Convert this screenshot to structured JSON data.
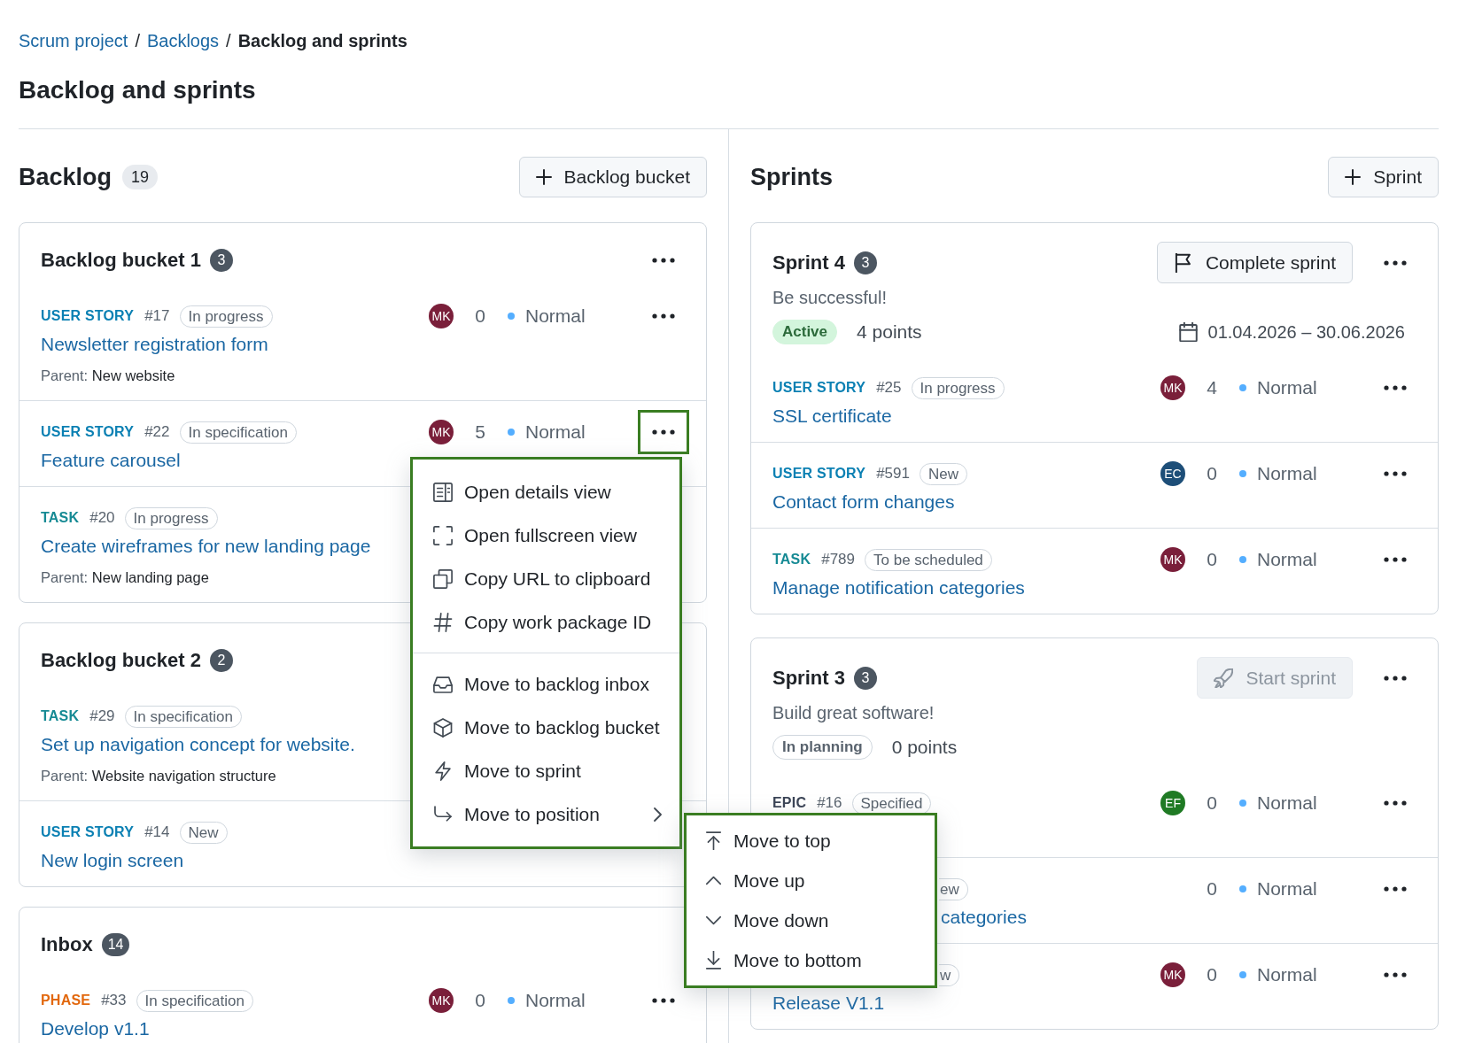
{
  "breadcrumb": {
    "separator": "/",
    "items": [
      {
        "label": "Scrum project",
        "current": false
      },
      {
        "label": "Backlogs",
        "current": false
      },
      {
        "label": "Backlog and sprints",
        "current": true
      }
    ]
  },
  "page_title": "Backlog and sprints",
  "backlog": {
    "title": "Backlog",
    "count": "19",
    "add_button": "Backlog bucket",
    "buckets": [
      {
        "name": "Backlog bucket 1",
        "count": "3",
        "menu": {
          "open": false
        },
        "items": [
          {
            "type": "USER STORY",
            "color": "#0b80b3",
            "number": "#17",
            "status": "In progress",
            "assignee": {
              "initials": "MK",
              "color": "#7a1f3a"
            },
            "points": "0",
            "priority": "Normal",
            "menu": {
              "open": false
            },
            "title": "Newsletter registration form",
            "parent": {
              "label": "Parent:",
              "name": "New website"
            }
          },
          {
            "type": "USER STORY",
            "color": "#0b80b3",
            "number": "#22",
            "status": "In specification",
            "assignee": {
              "initials": "MK",
              "color": "#7a1f3a"
            },
            "points": "5",
            "priority": "Normal",
            "menu": {
              "open": true
            },
            "title": "Feature carousel"
          },
          {
            "type": "TASK",
            "color": "#168a94",
            "number": "#20",
            "status": "In progress",
            "title": "Create wireframes for new landing page",
            "parent": {
              "label": "Parent:",
              "name": "New landing page"
            }
          }
        ]
      },
      {
        "name": "Backlog bucket 2",
        "count": "2",
        "items": [
          {
            "type": "TASK",
            "color": "#168a94",
            "number": "#29",
            "status": "In specification",
            "title": "Set up navigation concept for website.",
            "parent": {
              "label": "Parent:",
              "name": "Website navigation structure"
            }
          },
          {
            "type": "USER STORY",
            "color": "#0b80b3",
            "number": "#14",
            "status": "New",
            "title": "New login screen"
          }
        ]
      },
      {
        "name": "Inbox",
        "count": "14",
        "items": [
          {
            "type": "PHASE",
            "color": "#e2680e",
            "number": "#33",
            "status": "In specification",
            "assignee": {
              "initials": "MK",
              "color": "#7a1f3a"
            },
            "points": "0",
            "priority": "Normal",
            "menu": {
              "open": false
            },
            "title": "Develop v1.1"
          }
        ]
      }
    ]
  },
  "sprints": {
    "title": "Sprints",
    "add_button": "Sprint",
    "items": [
      {
        "name": "Sprint 4",
        "count": "3",
        "action": {
          "label": "Complete sprint",
          "kind": "complete",
          "disabled": false
        },
        "menu": {
          "open": false
        },
        "goal": "Be successful!",
        "state": {
          "label": "Active",
          "kind": "active"
        },
        "points": "4 points",
        "dates": "01.04.2026 – 30.06.2026",
        "items": [
          {
            "type": "USER STORY",
            "color": "#0b80b3",
            "number": "#25",
            "status": "In progress",
            "assignee": {
              "initials": "MK",
              "color": "#7a1f3a"
            },
            "points": "4",
            "priority": "Normal",
            "menu": {
              "open": false
            },
            "title": "SSL certificate"
          },
          {
            "type": "USER STORY",
            "color": "#0b80b3",
            "number": "#591",
            "status": "New",
            "assignee": {
              "initials": "EC",
              "color": "#1d4e78"
            },
            "points": "0",
            "priority": "Normal",
            "menu": {
              "open": false
            },
            "title": "Contact form changes"
          },
          {
            "type": "TASK",
            "color": "#168a94",
            "number": "#789",
            "status": "To be scheduled",
            "assignee": {
              "initials": "MK",
              "color": "#7a1f3a"
            },
            "points": "0",
            "priority": "Normal",
            "menu": {
              "open": false
            },
            "title": "Manage notification categories"
          }
        ]
      },
      {
        "name": "Sprint 3",
        "count": "3",
        "action": {
          "label": "Start sprint",
          "kind": "start",
          "disabled": true
        },
        "menu": {
          "open": false
        },
        "goal": "Build great software!",
        "state": {
          "label": "In planning",
          "kind": "planning"
        },
        "points": "0 points",
        "items": [
          {
            "type": "EPIC",
            "color": "#3b4456",
            "number": "#16",
            "status": "Specified",
            "assignee": {
              "initials": "EF",
              "color": "#1f7a24"
            },
            "points": "0",
            "priority": "Normal",
            "menu": {
              "open": false
            }
          },
          {
            "status_fragment": "ew",
            "points": "0",
            "priority": "Normal",
            "menu": {
              "open": false
            },
            "title_fragment": "categories"
          },
          {
            "status_fragment": "w",
            "assignee": {
              "initials": "MK",
              "color": "#7a1f3a"
            },
            "points": "0",
            "priority": "Normal",
            "menu": {
              "open": false
            },
            "title": "Release V1.1"
          }
        ]
      }
    ]
  },
  "context_menu": {
    "groups": [
      {
        "items": [
          {
            "label": "Open details view",
            "kind": "details"
          },
          {
            "label": "Open fullscreen view",
            "kind": "fullscreen"
          },
          {
            "label": "Copy URL to clipboard",
            "kind": "copy"
          },
          {
            "label": "Copy work package ID",
            "kind": "id"
          }
        ]
      },
      {
        "items": [
          {
            "label": "Move to backlog inbox",
            "kind": "inbox"
          },
          {
            "label": "Move to backlog bucket",
            "kind": "bucket"
          },
          {
            "label": "Move to sprint",
            "kind": "sprint"
          },
          {
            "label": "Move to position",
            "kind": "position",
            "submenu": {
              "items": [
                {
                  "label": "Move to top",
                  "kind": "top"
                },
                {
                  "label": "Move up",
                  "kind": "up"
                },
                {
                  "label": "Move down",
                  "kind": "down"
                },
                {
                  "label": "Move to bottom",
                  "kind": "bottom"
                }
              ]
            }
          }
        ]
      }
    ]
  }
}
